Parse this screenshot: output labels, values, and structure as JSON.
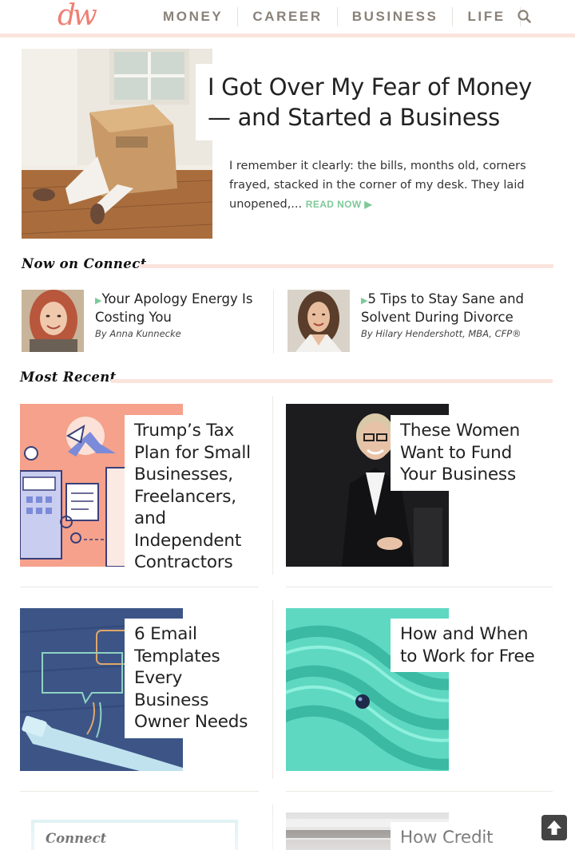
{
  "brand": {
    "logo_text": "dw",
    "accent": "#ef7f72",
    "green": "#7fc99a",
    "rule_color": "#fbe3de"
  },
  "nav": {
    "items": [
      "MONEY",
      "CAREER",
      "BUSINESS",
      "LIFE"
    ],
    "search_icon": "search-icon"
  },
  "hero": {
    "title": "I Got Over My Fear of Money — and Started a Business",
    "excerpt": "I remember it clearly: the bills, months old, corners frayed, stacked in the corner of my desk. They laid unopened,...",
    "read_now": "READ NOW",
    "read_now_icon": "play-triangle-icon"
  },
  "now_on_connect": {
    "heading": "Now on Connect",
    "items": [
      {
        "title": "Your Apology Energy Is Costing You",
        "author": "By Anna Kunnecke"
      },
      {
        "title": "5 Tips to Stay Sane and Solvent During Divorce",
        "author": "By Hilary Hendershott, MBA, CFP®"
      }
    ]
  },
  "most_recent": {
    "heading": "Most Recent",
    "cards": [
      {
        "title": "Trump’s Tax Plan for Small Businesses, Freelancers, and Independent Contractors"
      },
      {
        "title": "These Women Want to Fund Your Business"
      },
      {
        "title": "6 Email Templates Every Business Owner Needs"
      },
      {
        "title": "How and When to Work for Free"
      },
      {
        "title": "How Credit Card"
      }
    ]
  },
  "sidebar": {
    "connect_title": "Connect"
  },
  "back_to_top_icon": "arrow-up-icon"
}
